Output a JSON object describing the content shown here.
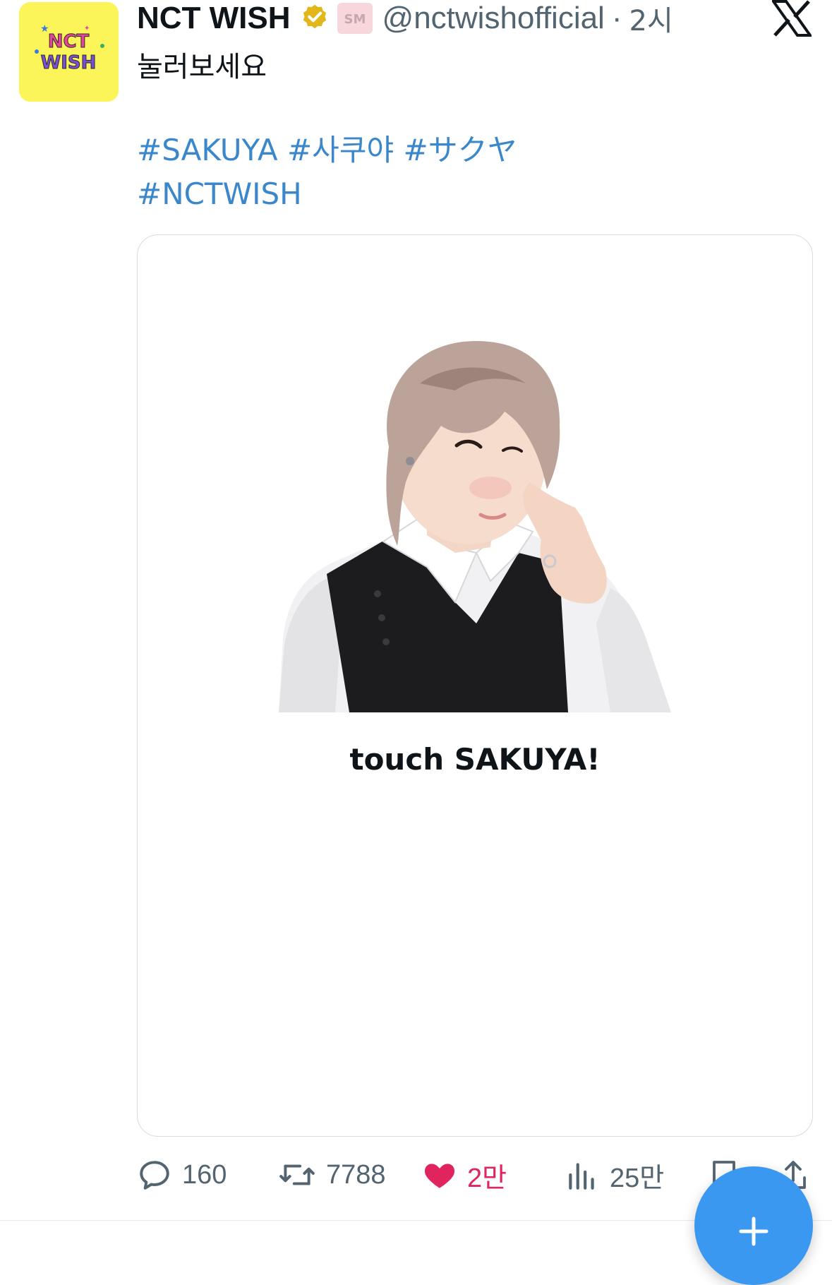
{
  "tweet": {
    "author": {
      "display_name": "NCT WISH",
      "handle": "@nctwishofficial",
      "avatar_text_top": "NCT",
      "avatar_text_bottom": "WISH",
      "affiliation_badge": "SM"
    },
    "separator": "·",
    "time": "2시",
    "text": "눌러보세요",
    "hashtags_line1": "#SAKUYA #사쿠야 #サクヤ",
    "hashtags_line2": "#NCTWISH",
    "card": {
      "caption": "touch SAKUYA!"
    },
    "actions": {
      "replies": "160",
      "retweets": "7788",
      "likes": "2만",
      "views": "25만"
    }
  },
  "icons": {
    "platform": "x-logo-icon",
    "verified": "verified-badge-icon",
    "reply": "reply-icon",
    "retweet": "retweet-icon",
    "like": "heart-icon",
    "views": "views-icon",
    "bookmark": "bookmark-icon",
    "share": "share-icon",
    "compose": "plus-icon"
  },
  "colors": {
    "link": "#3a87cc",
    "like": "#e0245e",
    "fab": "#3b98f1",
    "avatar_bg": "#fbf55a"
  }
}
